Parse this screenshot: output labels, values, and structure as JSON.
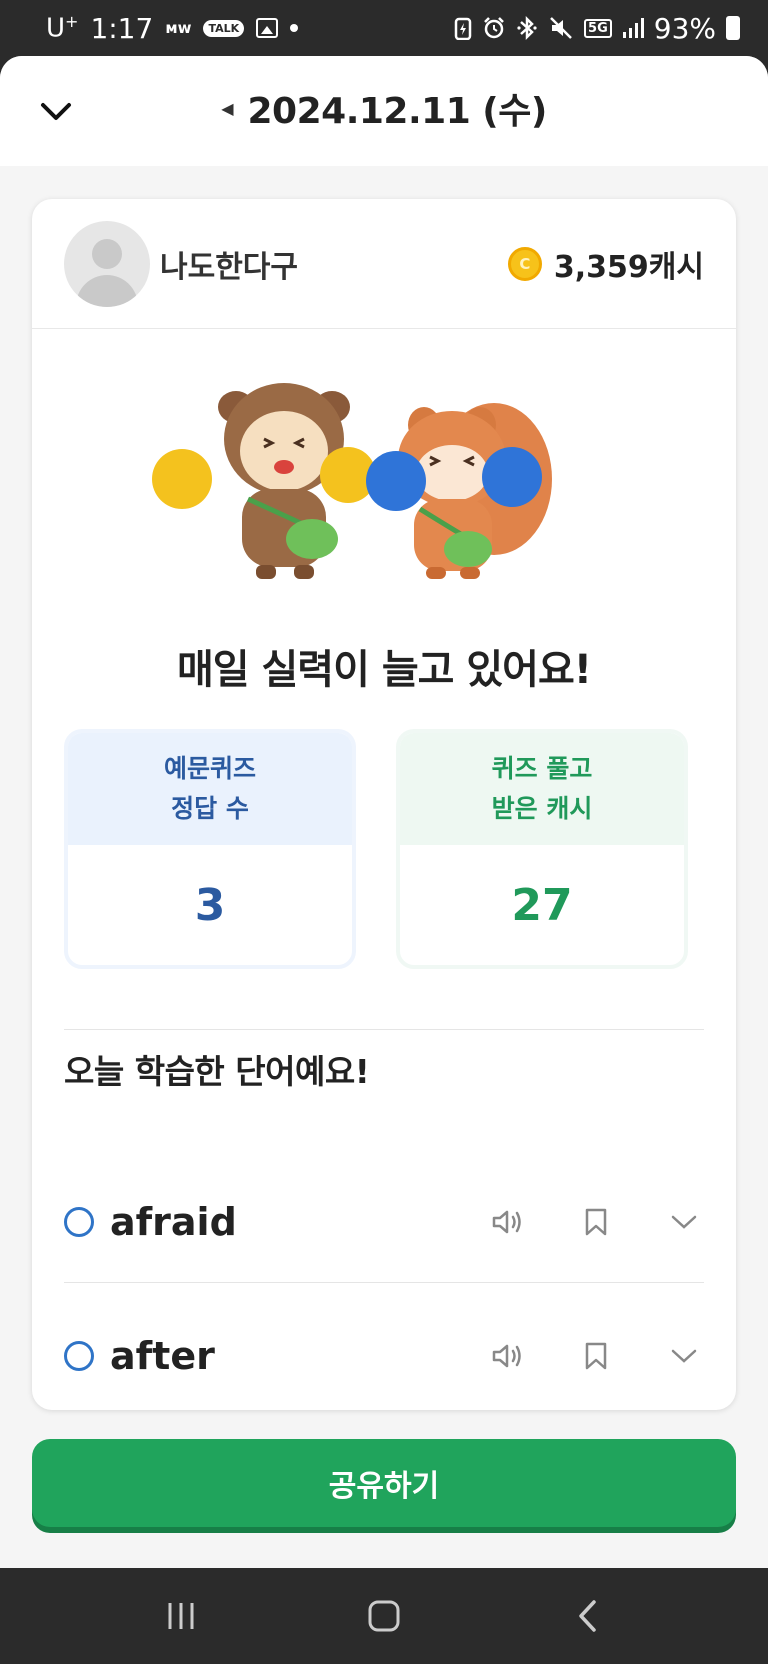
{
  "status_bar": {
    "carrier": "U",
    "carrier_sup": "+",
    "time": "1:17",
    "mw": "ᴍᴡ",
    "talk": "TALK",
    "network": "5G",
    "battery": "93%",
    "icons": [
      "talk-icon",
      "gallery-icon",
      "dot-icon",
      "battery-saver-icon",
      "alarm-icon",
      "bluetooth-icon",
      "mute-icon",
      "signal-icon",
      "battery-icon"
    ]
  },
  "header": {
    "collapse_icon": "chevron-down-icon",
    "prev_icon": "caret-left-icon",
    "date": "2024.12.11 (수)"
  },
  "profile": {
    "nickname": "나도한다구",
    "coin_symbol": "C",
    "cash": "3,359캐시"
  },
  "headline": "매일 실력이 늘고 있어요!",
  "stats": [
    {
      "label_line1": "예문퀴즈",
      "label_line2": "정답 수",
      "value": "3",
      "color": "#2b5aa0"
    },
    {
      "label_line1": "퀴즈 풀고",
      "label_line2": "받은 캐시",
      "value": "27",
      "color": "#20995a"
    }
  ],
  "words_section": {
    "title": "오늘 학습한 단어예요!",
    "words": [
      {
        "word": "afraid"
      },
      {
        "word": "after"
      }
    ]
  },
  "share_button": "공유하기",
  "colors": {
    "accent_green": "#20a45c",
    "accent_blue": "#2f74c7"
  },
  "nav": [
    "recent-apps-icon",
    "home-icon",
    "back-icon"
  ]
}
